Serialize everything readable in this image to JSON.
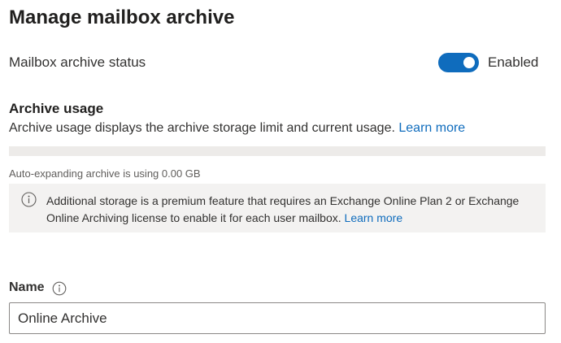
{
  "page": {
    "title": "Manage mailbox archive"
  },
  "archive_status": {
    "label": "Mailbox archive status",
    "toggle_on": true,
    "toggle_text": "Enabled",
    "accent_color": "#0f6cbd"
  },
  "archive_usage": {
    "heading": "Archive usage",
    "description": "Archive usage displays the archive storage limit and current usage.",
    "learn_more": "Learn more",
    "usage_fraction": 0,
    "auto_expanding_note": "Auto-expanding archive is using 0.00 GB"
  },
  "info_box": {
    "icon": "info-icon",
    "text": "Additional storage is a premium feature that requires an Exchange Online Plan 2 or Exchange Online Archiving license to enable it for each user mailbox.",
    "learn_more": "Learn more"
  },
  "name_field": {
    "label": "Name",
    "label_icon": "info-icon",
    "value": "Online Archive"
  }
}
